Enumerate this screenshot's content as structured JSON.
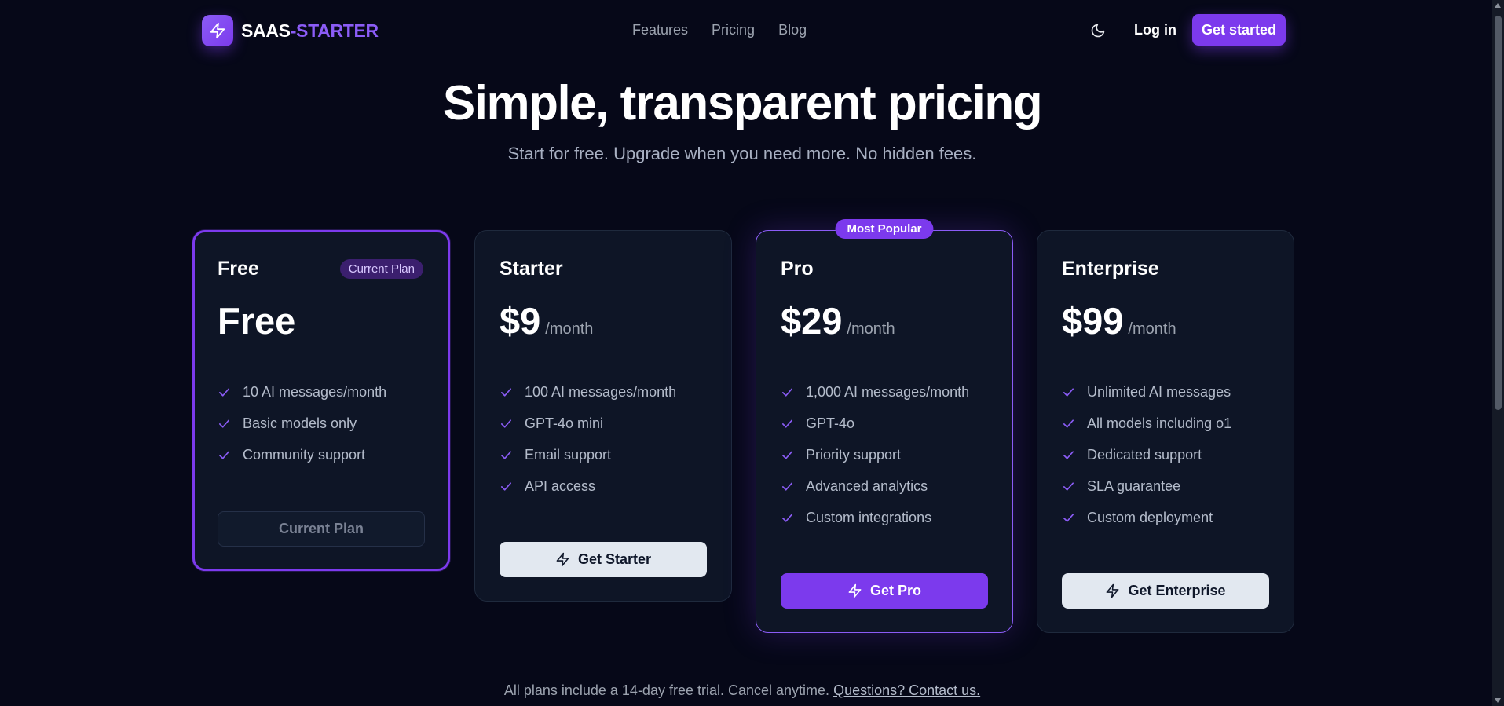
{
  "brand": {
    "part1": "SAAS",
    "part2": "-STARTER",
    "icon": "bolt-icon"
  },
  "nav": {
    "items": [
      "Features",
      "Pricing",
      "Blog"
    ]
  },
  "header": {
    "login_label": "Log in",
    "cta_label": "Get started",
    "theme_icon": "moon-icon"
  },
  "hero": {
    "title": "Simple, transparent pricing",
    "subtitle": "Start for free. Upgrade when you need more. No hidden fees."
  },
  "plans": [
    {
      "name": "Free",
      "badge": "Current Plan",
      "price": "Free",
      "period": "",
      "features": [
        "10 AI messages/month",
        "Basic models only",
        "Community support"
      ],
      "button": "Current Plan"
    },
    {
      "name": "Starter",
      "price": "$9",
      "period": "/month",
      "features": [
        "100 AI messages/month",
        "GPT-4o mini",
        "Email support",
        "API access"
      ],
      "button": "Get Starter"
    },
    {
      "name": "Pro",
      "badge": "Most Popular",
      "price": "$29",
      "period": "/month",
      "features": [
        "1,000 AI messages/month",
        "GPT-4o",
        "Priority support",
        "Advanced analytics",
        "Custom integrations"
      ],
      "button": "Get Pro"
    },
    {
      "name": "Enterprise",
      "price": "$99",
      "period": "/month",
      "features": [
        "Unlimited AI messages",
        "All models including o1",
        "Dedicated support",
        "SLA guarantee",
        "Custom deployment"
      ],
      "button": "Get Enterprise"
    }
  ],
  "footer": {
    "note": "All plans include a 14-day free trial. Cancel anytime.",
    "link": "Questions? Contact us."
  },
  "colors": {
    "background": "#060818",
    "card": "#0e1526",
    "accent": "#7c3aed",
    "accent_light": "#8b5cf6"
  }
}
